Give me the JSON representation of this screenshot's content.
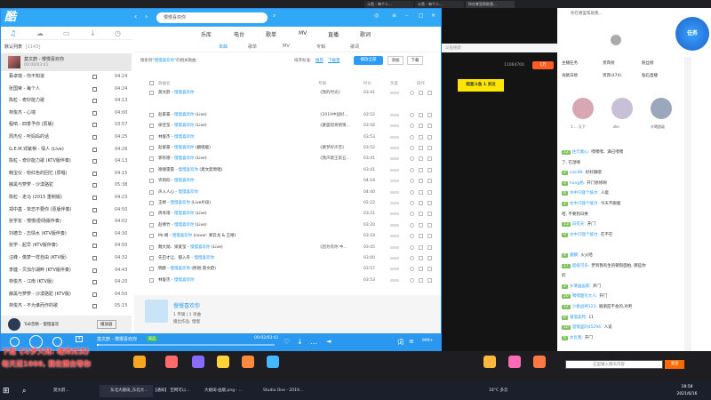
{
  "browser_tabs": [
    {
      "label": "斗鱼 - 每个人..."
    },
    {
      "label": "斗鱼 - 每个人..."
    },
    {
      "label": "斗鱼直播 - 每个人..."
    },
    {
      "label": "斗鱼 - 每个人..."
    },
    {
      "label": "斗鱼直播 每个人..."
    },
    {
      "label": "东北大嫂..."
    },
    {
      "label": "你在哪里帮助我..."
    }
  ],
  "player": {
    "search_value": "慢慢喜欢你",
    "top_nav": [
      "乐库",
      "电台",
      "歌单",
      "MV",
      "直播",
      "歌词"
    ],
    "sub_nav": [
      "单曲",
      "歌单",
      "MV",
      "专辑",
      "歌词"
    ],
    "search_hint_prefix": "搜索到",
    "search_hint_query": "\"慢慢喜欢你\"",
    "search_hint_suffix": "的相关歌曲",
    "sort_label": "排序标准:",
    "sort_options": [
      "推荐",
      "下载量"
    ],
    "play_all": "播放全部",
    "add": "添加",
    "download": "下载",
    "col_headers": {
      "name": "歌曲名",
      "album": "专辑",
      "duration": "时长",
      "hot": "热度",
      "ops": "操作"
    },
    "playlist_title": "默认列表",
    "playlist_count": "[1143]",
    "now_playing": {
      "title": "莫文蔚 - 慢慢喜欢你",
      "sub": "00:00/03:41"
    },
    "user": {
      "name": "TaB音精 - 慢慢喜欢",
      "btn": "播放器"
    },
    "singer": {
      "name": "慢慢喜欢你",
      "line1": "1 专辑 | 1 单曲",
      "line2": "播出作品: 慢慢"
    },
    "bottom": {
      "title": "莫文蔚 - 慢慢喜欢你",
      "tag": "高品",
      "time": "00:02/03:41",
      "count": "999+"
    }
  },
  "playlist": [
    {
      "t": "蔡卓琪 - 你不知道",
      "d": "04:24"
    },
    {
      "t": "张国荣 - 每个人",
      "d": "04:24"
    },
    {
      "t": "陈粒 - 奇妙能力歌",
      "d": "04:13"
    },
    {
      "t": "林俊杰 - 心墙",
      "d": "04:00"
    },
    {
      "t": "程响 - 四季予你 (原版)",
      "d": "03:57"
    },
    {
      "t": "周杰伦 - 听妈妈的话",
      "d": "04:25"
    },
    {
      "t": "G.E.M.邓紫棋 - 情人 (Live)",
      "d": "04:26"
    },
    {
      "t": "陈粒 - 奇妙能力歌 (KTV版伴奏)",
      "d": "04:13"
    },
    {
      "t": "韩宝仪 - 粉红色的回忆 (原唱)",
      "d": "04:15"
    },
    {
      "t": "薛黑与萝萝 - 沙漠骆驼",
      "d": "05:38"
    },
    {
      "t": "陈粒 - 走马 (2015 重制版)",
      "d": "04:23"
    },
    {
      "t": "郑中基 - 单恋不要你 (原版伴奏)",
      "d": "04:50"
    },
    {
      "t": "张学友 - 慢慢(剧场版伴奏)",
      "d": "04:02"
    },
    {
      "t": "刘德华 - 忘情水 (KTV版伴奏)",
      "d": "04:30"
    },
    {
      "t": "张学 - 起早 (KTV版伴奏)",
      "d": "04:50"
    },
    {
      "t": "汪峰 - 像梦一样自由 (KTV版)",
      "d": "04:32"
    },
    {
      "t": "李健 - 贝加尔湖畔 (KTV版伴奏)",
      "d": "04:43"
    },
    {
      "t": "林俊杰 - 江南 (KTV版)",
      "d": "04:20"
    },
    {
      "t": "薛黑与萝萝 - 沙漠骆驼 (KTV版)",
      "d": "04:50"
    },
    {
      "t": "林俊杰 - 不为谁而作的歌",
      "d": "05:15"
    }
  ],
  "results": [
    {
      "a": "莫文蔚",
      "s": "慢慢喜欢你",
      "x": "",
      "al": "《我的时光》",
      "d": "03:41"
    },
    {
      "a": "",
      "s": "",
      "x": "",
      "al": "",
      "d": ""
    },
    {
      "a": "赵家豪",
      "s": "慢慢喜欢你",
      "x": " (Live)",
      "al": "《2019中国好...",
      "d": "03:52"
    },
    {
      "a": "徐佳莹",
      "s": "慢慢喜欢你",
      "x": " (Live)",
      "al": "《蒙面唱将猜猜...",
      "d": "03:56"
    },
    {
      "a": "林俊杰",
      "s": "慢慢喜欢你",
      "x": "",
      "al": "",
      "d": "03:53"
    },
    {
      "a": "赵家豪",
      "s": "慢慢喜欢你",
      "x": " (翻唱版)",
      "al": "《慕梦好声音》",
      "d": "03:52"
    },
    {
      "a": "郭有德",
      "s": "慢慢喜欢你",
      "x": " (Live)",
      "al": "《我声歌王第五...",
      "d": "03:41"
    },
    {
      "a": "德德雷雷",
      "s": "慢慢喜欢你",
      "x": " (莫文蔚原唱)",
      "al": "",
      "d": "03:41"
    },
    {
      "a": "许莉仰",
      "s": "慢慢喜欢你",
      "x": "",
      "al": "",
      "d": "04:18"
    },
    {
      "a": "声入人心",
      "s": "慢慢喜欢你",
      "x": "",
      "al": "",
      "d": "04:40"
    },
    {
      "a": "王婷",
      "s": "慢慢喜欢你",
      "x": " (Live片段)",
      "al": "",
      "d": "02:22"
    },
    {
      "a": "周冬雨",
      "s": "慢慢喜欢你",
      "x": " (Live)",
      "al": "",
      "d": "03:21"
    },
    {
      "a": "赵倩竹",
      "s": "慢慢喜欢你",
      "x": " (Live)",
      "al": "",
      "d": "03:20"
    },
    {
      "a": "Mr.胡",
      "s": "慢慢喜欢你",
      "x": " (cover: 郑云龙 & 王晰)",
      "al": "",
      "d": "03:18"
    },
    {
      "a": "魏大勋、梁爱莹",
      "s": "慢慢喜欢你",
      "x": " (Live)",
      "al": "《因为有你 中...",
      "d": "03:45"
    },
    {
      "a": "先巴才让、都入舟",
      "s": "慢慢喜欢你",
      "x": "",
      "al": "",
      "d": "03:00"
    },
    {
      "a": "明欧",
      "s": "慢慢喜欢你",
      "x": " (原唱:莫文蔚)",
      "al": "",
      "d": "03:57"
    },
    {
      "a": "林俊杰",
      "s": "慢慢喜欢你",
      "x": "",
      "al": "",
      "d": "03:53"
    }
  ],
  "live": {
    "search_placeholder": "斗鱼搜索",
    "fans_tabs": [
      "主播任务",
      "贵宾榜",
      "粉丝榜"
    ],
    "gift_tabs": [
      "贡献日榜",
      "贵宾(474)",
      "粘石直播"
    ],
    "viewer_badge": "11064700",
    "followers": "1万",
    "title_banner": "超星斗鱼 1 关注",
    "rank_labels": [
      "1 ... 天下",
      "zkn",
      "许曦超级"
    ],
    "messages": [
      {
        "lv": "12",
        "nm": "往元素心:",
        "txt": "嘿嘿嘿、满已嘿嘿"
      },
      {
        "lv": "",
        "nm": "",
        "txt": "了, 在湿嘀"
      },
      {
        "lv": "2",
        "nm": "sasi98:",
        "txt": "好好跟嗯"
      },
      {
        "lv": "3",
        "nm": "hong扬:",
        "txt": "开门修修啊"
      },
      {
        "lv": "6",
        "nm": "水中只骚个纸巾:",
        "txt": "人能"
      },
      {
        "lv": "2",
        "nm": "太中只骚个纸巾:",
        "txt": "今天不跟鹿"
      },
      {
        "lv": "",
        "nm": "",
        "txt": "哈, 不要狗日拼"
      },
      {
        "lv": "13",
        "nm": "白衣天:",
        "txt": "开门"
      },
      {
        "lv": "9",
        "nm": "水中只骚个纸巾:",
        "txt": "在不在"
      },
      {
        "lv": "",
        "nm": "",
        "txt": ""
      },
      {
        "lv": "4",
        "nm": "嘉麟:",
        "txt": "火火哈"
      },
      {
        "lv": "17",
        "nm": "超级可乐:",
        "txt": "梦到我有生的朝刻面拍, 哪些你"
      },
      {
        "lv": "",
        "nm": "",
        "txt": "的"
      },
      {
        "lv": "2",
        "nm": "乡情画画家:",
        "txt": "开门"
      },
      {
        "lv": "20",
        "nm": "嘿嘿面包大人:",
        "txt": "开门"
      },
      {
        "lv": "12",
        "nm": "小桃战神123:",
        "txt": "朋朋是不会的,对吧"
      },
      {
        "lv": "8",
        "nm": "溜溜美死:",
        "txt": "11"
      },
      {
        "lv": "10",
        "nm": "温情里的45294:",
        "txt": "人说"
      },
      {
        "lv": "6",
        "nm": "水负我:",
        "txt": "开门"
      }
    ],
    "chat_placeholder": "这里输入聊天内容",
    "send": "发送"
  },
  "overlay": {
    "line1": "下载《斗罗大陆: 魂师对决》",
    "line2": "每天送1000, 我在擂台等你"
  },
  "taskbar": [
    {
      "label": "莫文蔚..."
    },
    {
      "label": "东北大嫂闺_东北大..."
    },
    {
      "label": "【通知】 空网可以..."
    },
    {
      "label": "大嫂闺-画版.png - ..."
    },
    {
      "label": "Studio One - 2019..."
    }
  ],
  "clock": {
    "time": "18:58",
    "date": "2021/6/16",
    "weather": "18°C 多云"
  },
  "colors": {
    "accent": "#2b9cf5",
    "title": "#31a8f5",
    "orange": "#ff6a00"
  }
}
